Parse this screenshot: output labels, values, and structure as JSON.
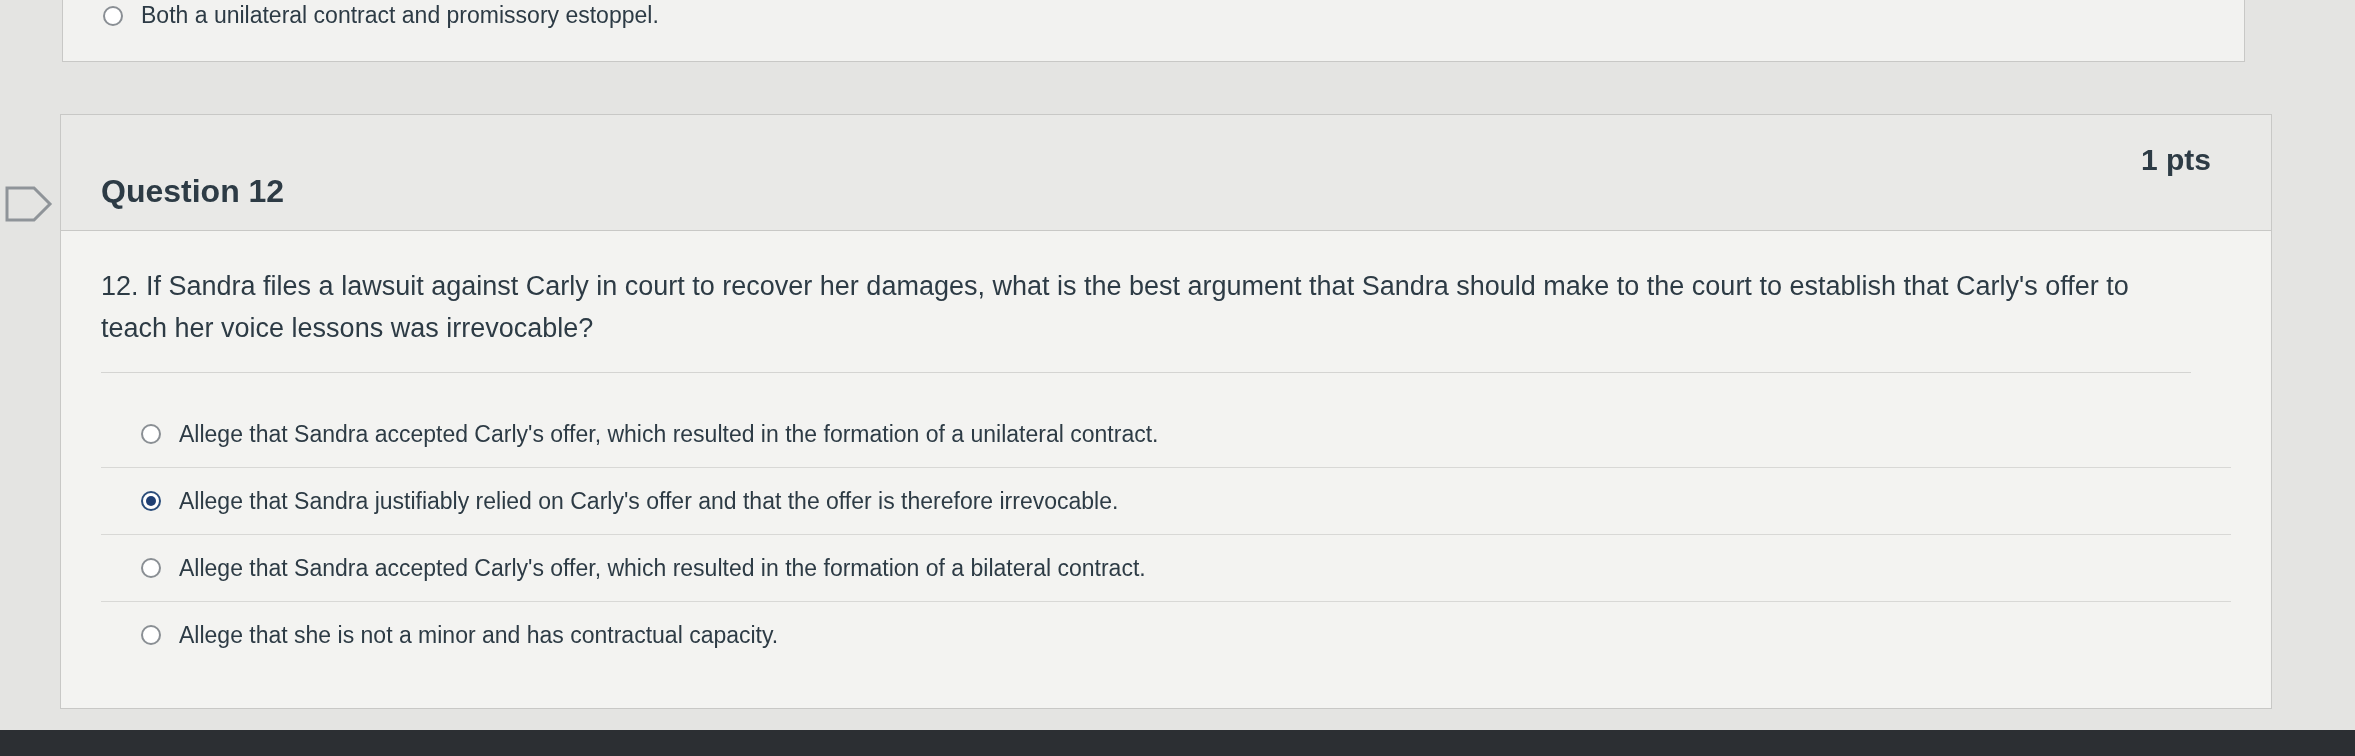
{
  "previous_question": {
    "options": [
      {
        "label": "Both a unilateral contract and promissory estoppel.",
        "selected": false
      }
    ]
  },
  "question": {
    "title": "Question 12",
    "points": "1 pts",
    "text": "12.  If Sandra files a lawsuit against Carly in court to recover her damages, what is the best argument that Sandra should make to the court to establish that Carly's offer to teach her voice lessons was irrevocable?",
    "options": [
      {
        "label": "Allege that Sandra accepted Carly's offer, which resulted in the formation of a unilateral contract.",
        "selected": false
      },
      {
        "label": "Allege that Sandra justifiably relied on Carly's offer and that the offer is therefore irrevocable.",
        "selected": true
      },
      {
        "label": "Allege that Sandra accepted Carly's offer, which resulted in the formation of a bilateral contract.",
        "selected": false
      },
      {
        "label": "Allege that she is not a minor and has contractual capacity.",
        "selected": false
      }
    ]
  }
}
